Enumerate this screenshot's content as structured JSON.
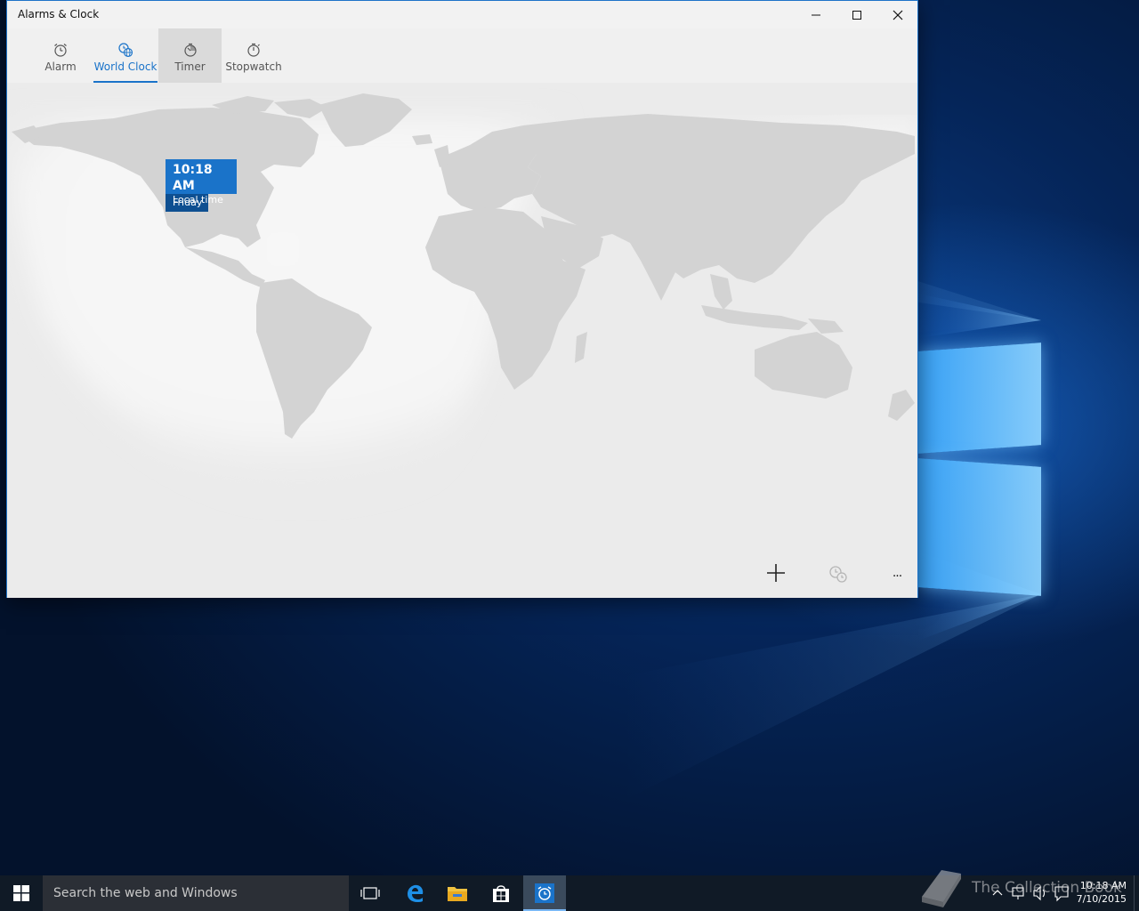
{
  "window": {
    "title": "Alarms & Clock"
  },
  "tabs": [
    {
      "label": "Alarm",
      "icon": "alarm-clock-icon"
    },
    {
      "label": "World Clock",
      "icon": "world-clock-icon",
      "active": true
    },
    {
      "label": "Timer",
      "icon": "timer-icon"
    },
    {
      "label": "Stopwatch",
      "icon": "stopwatch-icon"
    }
  ],
  "clock_card": {
    "time": "10:18 AM",
    "label": "Local time",
    "day": "Friday"
  },
  "commands": {
    "add_icon": "plus-icon",
    "compare_icon": "compare-time-icon",
    "more_icon": "more-ellipsis-icon",
    "more_glyph": "···"
  },
  "taskbar": {
    "search_placeholder": "Search the web and Windows",
    "tray_time": "10:18 AM",
    "tray_date": "7/10/2015"
  },
  "watermark": {
    "text": "The Collection Book"
  },
  "colors": {
    "accent": "#1a73c9",
    "accent_dark": "#0e4f91",
    "land": "#d3d3d3",
    "map_background": "#ebebeb",
    "taskbar": "#101a26"
  }
}
